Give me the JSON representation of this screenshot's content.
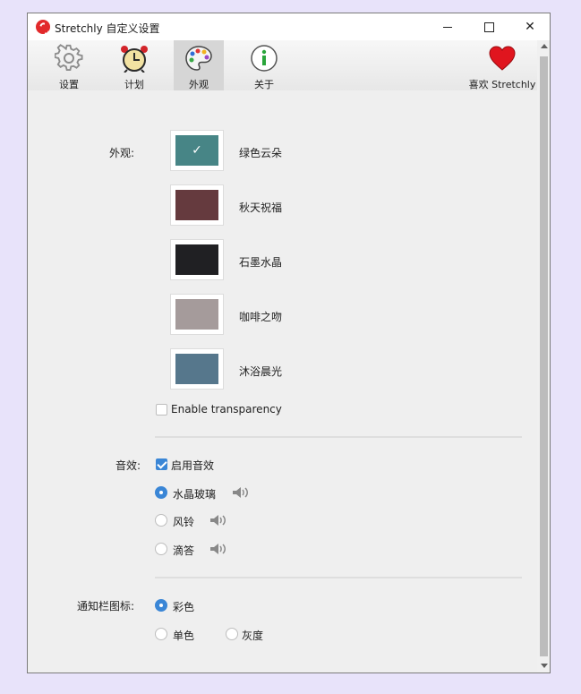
{
  "window": {
    "title": "Stretchly 自定义设置"
  },
  "toolbar": {
    "settings": "设置",
    "schedule": "计划",
    "appearance": "外观",
    "about": "关于",
    "love": "喜欢 Stretchly"
  },
  "appearance": {
    "label": "外观:",
    "themes": [
      {
        "name": "绿色云朵",
        "color": "#478586",
        "selected": true,
        "check": "✓"
      },
      {
        "name": "秋天祝福",
        "color": "#653a3e",
        "selected": false,
        "check": ""
      },
      {
        "name": "石墨水晶",
        "color": "#202023",
        "selected": false,
        "check": ""
      },
      {
        "name": "咖啡之吻",
        "color": "#a59b9b",
        "selected": false,
        "check": ""
      },
      {
        "name": "沐浴晨光",
        "color": "#56778c",
        "selected": false,
        "check": ""
      }
    ],
    "transparency_label": "Enable transparency",
    "transparency_checked": false
  },
  "sound": {
    "label": "音效:",
    "enable_label": "启用音效",
    "enable_checked": true,
    "options": [
      {
        "name": "水晶玻璃",
        "selected": true
      },
      {
        "name": "风铃",
        "selected": false
      },
      {
        "name": "滴答",
        "selected": false
      }
    ]
  },
  "tray_icon": {
    "label": "通知栏图标:",
    "options": [
      {
        "name": "彩色",
        "selected": true
      },
      {
        "name": "单色",
        "selected": false
      },
      {
        "name": "灰度",
        "selected": false
      }
    ]
  },
  "colors": {
    "accent": "#3a86d6",
    "heart": "#e0151e"
  }
}
